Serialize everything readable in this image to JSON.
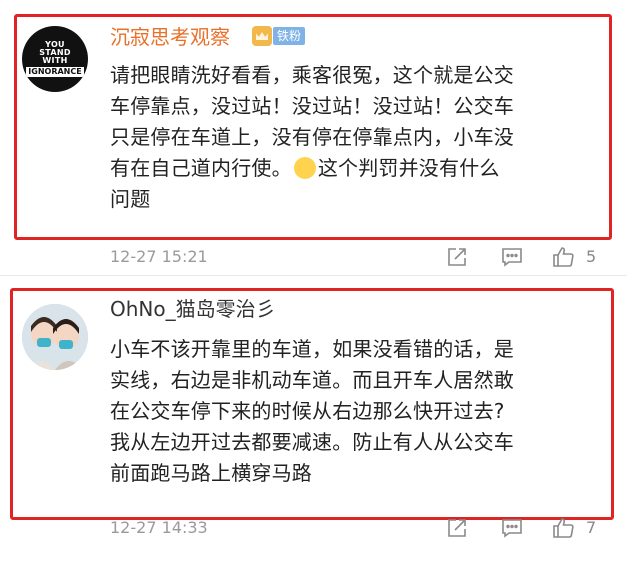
{
  "comments": [
    {
      "username": "沉寂思考观察",
      "badge": "铁粉",
      "avatar_text": [
        "YOU",
        "STAND",
        "WITH",
        "IGNORANCE"
      ],
      "body_lines": [
        "请把眼睛洗好看看，乘客很冤，这个就是公交",
        "车停靠点，没过站！没过站！没过站！公交车",
        "只是停在车道上，没有停在停靠点内，小车没",
        "有在自己道内行使。",
        "这个判罚并没有什么",
        "问题"
      ],
      "timestamp": "12-27 15:21",
      "like_count": "5"
    },
    {
      "username": "OhNo_猫岛零治彡",
      "body_lines": [
        "小车不该开靠里的车道，如果没看错的话，是",
        "实线，右边是非机动车道。而且开车人居然敢",
        "在公交车停下来的时候从右边那么快开过去?",
        "我从左边开过去都要减速。防止有人从公交车",
        "前面跑马路上横穿马路"
      ],
      "timestamp": "12-27 14:33",
      "like_count": "7"
    }
  ],
  "icons": {
    "share": "share-icon",
    "reply": "comment-icon",
    "like": "thumbs-up-icon",
    "emoji": "shrug-emoji-icon"
  },
  "colors": {
    "highlight": "#e02424",
    "username_accent": "#e8702a",
    "meta_gray": "#9a9a9a"
  }
}
